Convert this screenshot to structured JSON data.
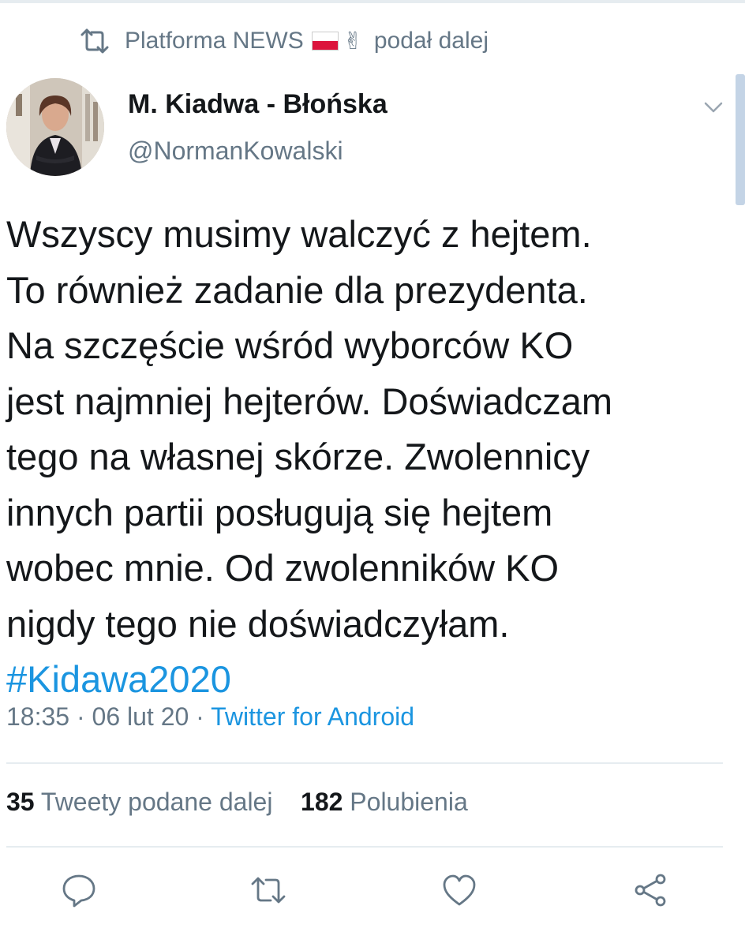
{
  "retweet": {
    "icon": "retweet-icon",
    "account_name": "Platforma NEWS",
    "flag_emoji": "🇵🇱",
    "emoji": "✌",
    "label": "podał dalej"
  },
  "author": {
    "name": "M. Kiadwa - Błońska",
    "handle": "@NormanKowalski",
    "avatar_icon": "avatar"
  },
  "tweet": {
    "lines": [
      "Wszyscy musimy walczyć z hejtem.",
      "To również zadanie dla prezydenta.",
      "Na szczęście wśród wyborców KO",
      "jest najmniej hejterów. Doświadczam",
      "tego na własnej skórze. Zwolennicy",
      "innych partii posługują się hejtem",
      "wobec mnie. Od zwolenników KO",
      "nigdy tego nie doświadczyłam."
    ],
    "hashtag": "#Kidawa2020"
  },
  "meta": {
    "time": "18:35",
    "separator": "·",
    "date": "06 lut 20",
    "source": "Twitter for Android"
  },
  "stats": {
    "retweets_count": "35",
    "retweets_label": "Tweety podane dalej",
    "likes_count": "182",
    "likes_label": "Polubienia"
  },
  "colors": {
    "text": "#14171a",
    "muted": "#657786",
    "link": "#1b95e0",
    "divider": "#e6ecf0"
  },
  "actions": [
    "reply-icon",
    "retweet-icon",
    "like-icon",
    "share-icon"
  ]
}
